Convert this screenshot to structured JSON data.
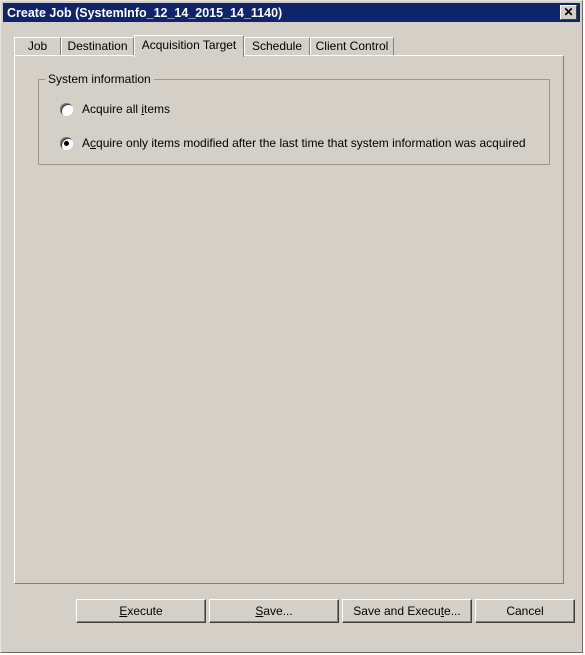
{
  "window": {
    "title": "Create Job (SystemInfo_12_14_2015_14_1140)",
    "close_icon": "close-icon",
    "close_glyph": "✕",
    "titlebar_color": "#10246b",
    "face_color": "#d4d0c8"
  },
  "tabs": [
    {
      "label": "Job",
      "selected": false
    },
    {
      "label": "Destination",
      "selected": false
    },
    {
      "label": "Acquisition Target",
      "selected": true
    },
    {
      "label": "Schedule",
      "selected": false
    },
    {
      "label": "Client Control",
      "selected": false
    }
  ],
  "panel": {
    "groupbox": {
      "title": "System information",
      "options": [
        {
          "label_before": "Acquire all ",
          "accel": "i",
          "label_after": "tems",
          "full_label": "Acquire all items",
          "checked": false
        },
        {
          "label_before": "A",
          "accel": "c",
          "label_after": "quire only items modified after the last time that system information was acquired",
          "full_label": "Acquire only items modified after the last time that system information was acquired",
          "checked": true
        }
      ]
    }
  },
  "buttons": [
    {
      "before": "",
      "accel": "E",
      "after": "xecute",
      "full_label": "Execute"
    },
    {
      "before": "",
      "accel": "S",
      "after": "ave...",
      "full_label": "Save..."
    },
    {
      "before": "Save and Execu",
      "accel": "t",
      "after": "e...",
      "full_label": "Save and Execute..."
    },
    {
      "before": "Cancel",
      "accel": "",
      "after": "",
      "full_label": "Cancel"
    }
  ]
}
